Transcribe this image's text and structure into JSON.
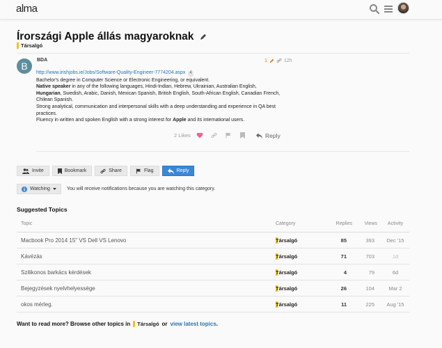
{
  "header": {
    "logo": "alma"
  },
  "topic": {
    "title": "Írországi Apple állás magyaroknak",
    "category": "Társalgó"
  },
  "post": {
    "avatar_letter": "B",
    "username": "BDA",
    "posts_count": "1",
    "age": "12h",
    "link": "http://www.irishjobs.ie/Jobs/Software-Quality-Engineer-7774204.aspx",
    "link_clicks": "4",
    "line1": "Bachelor's degree in Computer Science or Electronic Engineering, or equivalent.",
    "native_bold": "Native speaker",
    "native_rest": " in any of the following languages, Hindi-Indian, Hebrew, Ukrainian, Australian English,",
    "hungarian_bold": "Hungarian",
    "hungarian_rest": ", Swedish, Arabic, Danish, Mexican Spanish, British English, South-African English, Canadian French, Chilean Spanish.",
    "line4": "Strong analytical, communication and interpersonal skills with a deep understanding and experience in QA best practices.",
    "line5_pre": "Fluency in written and spoken English with a strong interest for ",
    "line5_bold": "Apple",
    "line5_post": " and its international users.",
    "likes": "2 Likes",
    "reply_label": "Reply"
  },
  "buttons": {
    "invite": "Invite",
    "bookmark": "Bookmark",
    "share": "Share",
    "flag": "Flag",
    "reply": "Reply"
  },
  "watching": {
    "label": "Watching",
    "note": "You will receive notifications because you are watching this category."
  },
  "suggested": {
    "title": "Suggested Topics",
    "headers": {
      "topic": "Topic",
      "category": "Category",
      "replies": "Replies",
      "views": "Views",
      "activity": "Activity"
    },
    "rows": [
      {
        "topic": "Macbook Pro 2014 15\" VS Dell VS Lenovo",
        "category": "Társalgó",
        "replies": "85",
        "views": "393",
        "activity": "Dec '15"
      },
      {
        "topic": "Kávézás",
        "category": "Társalgó",
        "replies": "71",
        "views": "703",
        "activity": "1d"
      },
      {
        "topic": "Szilikonos barkács kérdések",
        "category": "Társalgó",
        "replies": "4",
        "views": "79",
        "activity": "6d"
      },
      {
        "topic": "Bejegyzések nyelvhelyessége",
        "category": "Társalgó",
        "replies": "26",
        "views": "104",
        "activity": "Mar 2"
      },
      {
        "topic": "okos mérleg.",
        "category": "Társalgó",
        "replies": "11",
        "views": "225",
        "activity": "Aug '15"
      }
    ]
  },
  "footer": {
    "prefix": "Want to read more? Browse other topics in",
    "category": "Társalgó",
    "or": "or",
    "latest": "view latest topics",
    "suffix": "."
  },
  "colors": {
    "accent": "#3a87d8",
    "category": "#f1c40f",
    "link": "#2a72b5",
    "like": "#e8649a"
  }
}
